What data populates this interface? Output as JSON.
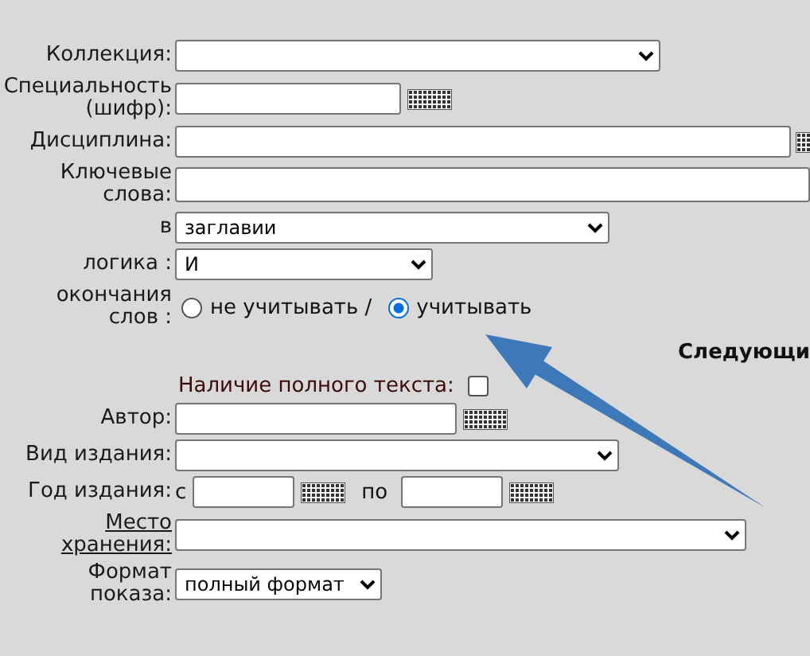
{
  "rows": [
    {
      "kind": "select",
      "label": "Коллекция:"
    },
    {
      "kind": "input_kbd",
      "label": "Специальность (шифр):"
    },
    {
      "kind": "input_kbd",
      "label": "Дисциплина:"
    },
    {
      "kind": "input",
      "label": "Ключевые слова:"
    },
    {
      "kind": "select",
      "label": "в",
      "value": "заглавии"
    },
    {
      "kind": "select",
      "label": "логика :",
      "value": "И"
    },
    {
      "kind": "radio",
      "label": "окончания слов :",
      "options": [
        {
          "label": "не учитывать /",
          "selected": false
        },
        {
          "label": "учитывать",
          "selected": true
        }
      ]
    },
    {
      "kind": "heading",
      "text": "Следующи"
    },
    {
      "kind": "checkbox",
      "label": "Наличие полного текста:",
      "checked": false
    },
    {
      "kind": "input_kbd",
      "label": "Автор:"
    },
    {
      "kind": "select",
      "label": "Вид издания:"
    },
    {
      "kind": "year",
      "label": "Год издания:",
      "from_label": "с",
      "to_label": "по"
    },
    {
      "kind": "select",
      "label": "Место хранения:",
      "link": true
    },
    {
      "kind": "select",
      "label": "Формат показа:",
      "value": "полный формат"
    }
  ]
}
